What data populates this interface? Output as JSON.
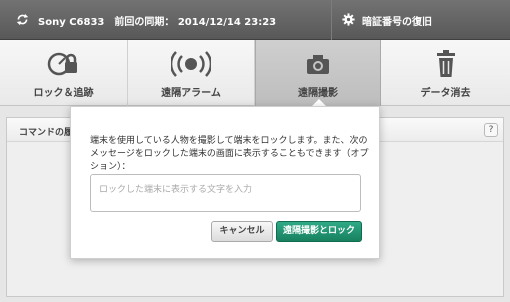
{
  "topbar": {
    "device_label": "Sony C6833　前回の同期： 2014/12/14 23:23",
    "restore_label": "暗証番号の復旧",
    "sync_icon": "sync-icon",
    "gear_icon": "gear-icon"
  },
  "tabs": [
    {
      "label": "ロック＆追跡",
      "icon": "lock-locate-icon",
      "active": false
    },
    {
      "label": "遠隔アラーム",
      "icon": "alarm-icon",
      "active": false
    },
    {
      "label": "遠隔撮影",
      "icon": "camera-icon",
      "active": true
    },
    {
      "label": "データ消去",
      "icon": "trash-icon",
      "active": false
    }
  ],
  "content": {
    "header": "コマンドの履",
    "help": "?"
  },
  "popup": {
    "message": "端末を使用している人物を撮影して端末をロックします。また、次のメッセージをロックした端末の画面に表示することもできます（オプション）：",
    "input_placeholder": "ロックした端末に表示する文字を入力",
    "input_value": "",
    "cancel_label": "キャンセル",
    "confirm_label": "遠隔撮影とロック"
  },
  "colors": {
    "topbar": "#626262",
    "accent_green": "#1f9470",
    "active_tab": "#c6c6c6"
  }
}
